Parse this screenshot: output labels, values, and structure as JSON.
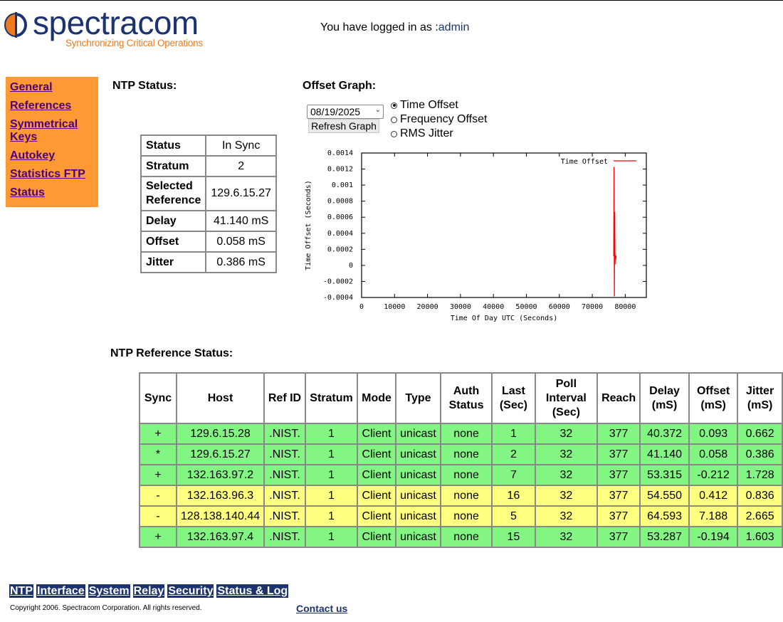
{
  "header": {
    "brand": "spectracom",
    "tagline": "Synchronizing Critical Operations",
    "login_prefix": "You have logged in as :",
    "login_user": "admin"
  },
  "left_nav": [
    "General",
    "References",
    "Symmetrical Keys",
    "Autokey",
    "Statistics FTP",
    "Status"
  ],
  "ntp_status": {
    "heading": "NTP Status:",
    "rows": [
      {
        "label": "Status",
        "value": "In Sync"
      },
      {
        "label": "Stratum",
        "value": "2"
      },
      {
        "label": "Selected Reference",
        "value": "129.6.15.27"
      },
      {
        "label": "Delay",
        "value": "41.140 mS"
      },
      {
        "label": "Offset",
        "value": "0.058 mS"
      },
      {
        "label": "Jitter",
        "value": "0.386 mS"
      }
    ]
  },
  "offset_graph": {
    "heading": "Offset Graph:",
    "date_value": "08/19/2025",
    "refresh_label": "Refresh Graph",
    "options": [
      {
        "label": "Time Offset",
        "selected": true
      },
      {
        "label": "Frequency Offset",
        "selected": false
      },
      {
        "label": "RMS Jitter",
        "selected": false
      }
    ]
  },
  "chart_data": {
    "type": "line",
    "title": "",
    "xlabel": "Time Of Day UTC (Seconds)",
    "ylabel": "Time Offset (Seconds)",
    "xlim": [
      0,
      86400
    ],
    "ylim": [
      -0.0004,
      0.0014
    ],
    "xticks": [
      "0",
      "10000",
      "20000",
      "30000",
      "40000",
      "50000",
      "60000",
      "70000",
      "80000"
    ],
    "yticks": [
      "0.0014",
      "0.0012",
      "0.001",
      "0.0008",
      "0.0006",
      "0.0004",
      "0.0002",
      "0",
      "-0.0002",
      "-0.0004"
    ],
    "series": [
      {
        "name": "Time Offset",
        "color": "#ff0000",
        "points": [
          [
            76500,
            0.00012
          ],
          [
            76600,
            0.00122
          ],
          [
            76700,
            -0.00038
          ],
          [
            76800,
            0.00066
          ],
          [
            76900,
            2e-05
          ],
          [
            77000,
            0.00012
          ],
          [
            77100,
            8e-05
          ],
          [
            77200,
            0.00011
          ]
        ]
      }
    ]
  },
  "ntp_reference": {
    "heading": "NTP Reference Status:",
    "columns": [
      "Sync",
      "Host",
      "Ref ID",
      "Stratum",
      "Mode",
      "Type",
      "Auth Status",
      "Last (Sec)",
      "Poll Interval (Sec)",
      "Reach",
      "Delay (mS)",
      "Offset (mS)",
      "Jitter (mS)"
    ],
    "rows": [
      {
        "color": "green",
        "cells": [
          "+",
          "129.6.15.28",
          ".NIST.",
          "1",
          "Client",
          "unicast",
          "none",
          "1",
          "32",
          "377",
          "40.372",
          "0.093",
          "0.662"
        ]
      },
      {
        "color": "green",
        "cells": [
          "*",
          "129.6.15.27",
          ".NIST.",
          "1",
          "Client",
          "unicast",
          "none",
          "2",
          "32",
          "377",
          "41.140",
          "0.058",
          "0.386"
        ]
      },
      {
        "color": "green",
        "cells": [
          "+",
          "132.163.97.2",
          ".NIST.",
          "1",
          "Client",
          "unicast",
          "none",
          "7",
          "32",
          "377",
          "53.315",
          "-0.212",
          "1.728"
        ]
      },
      {
        "color": "yellow",
        "cells": [
          "-",
          "132.163.96.3",
          ".NIST.",
          "1",
          "Client",
          "unicast",
          "none",
          "16",
          "32",
          "377",
          "54.550",
          "0.412",
          "0.836"
        ]
      },
      {
        "color": "yellow",
        "cells": [
          "-",
          "128.138.140.44",
          ".NIST.",
          "1",
          "Client",
          "unicast",
          "none",
          "5",
          "32",
          "377",
          "64.593",
          "7.188",
          "2.665"
        ]
      },
      {
        "color": "green",
        "cells": [
          "+",
          "132.163.97.4",
          ".NIST.",
          "1",
          "Client",
          "unicast",
          "none",
          "15",
          "32",
          "377",
          "53.287",
          "-0.194",
          "1.603"
        ]
      }
    ]
  },
  "bottom_nav": [
    "NTP",
    "Interface",
    "System",
    "Relay",
    "Security",
    "Status & Log"
  ],
  "footer": {
    "copyright": "Copyright 2006. Spectracom Corporation. All rights reserved.",
    "contact": "Contact us"
  }
}
